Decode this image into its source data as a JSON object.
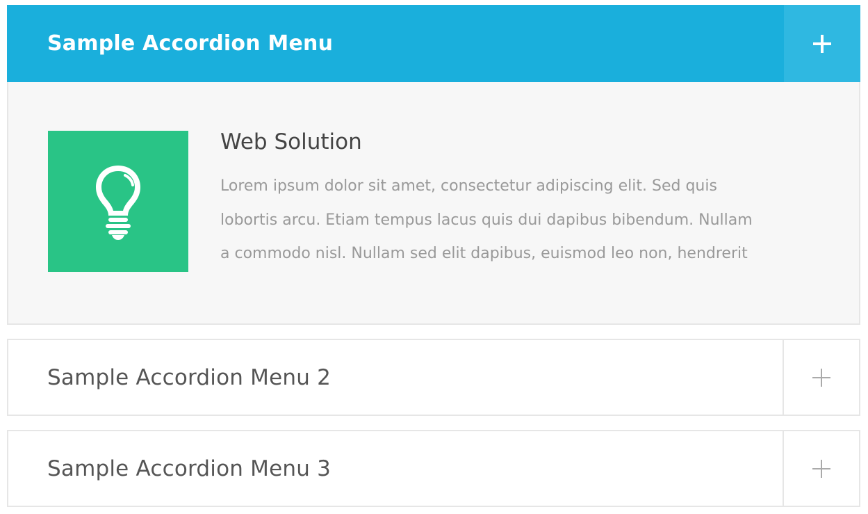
{
  "accordion": {
    "items": [
      {
        "title": "Sample Accordion Menu",
        "expanded": true,
        "toggle_icon": "plus-icon",
        "content": {
          "icon": "lightbulb-icon",
          "icon_bg_color": "#29c486",
          "heading": "Web Solution",
          "body": "Lorem ipsum dolor sit amet, consectetur adipiscing elit. Sed quis\nlobortis arcu. Etiam tempus lacus quis dui dapibus bibendum. Nullam\na commodo nisl. Nullam sed elit dapibus, euismod leo non, hendrerit"
        }
      },
      {
        "title": "Sample Accordion Menu 2",
        "expanded": false,
        "toggle_icon": "plus-icon"
      },
      {
        "title": "Sample Accordion Menu 3",
        "expanded": false,
        "toggle_icon": "plus-icon"
      }
    ]
  },
  "colors": {
    "active_header": "#1aafdc",
    "active_toggle": "#2fb8e1",
    "icon_box": "#29c486",
    "panel_bg": "#f7f7f7",
    "border": "#e6e6e6"
  }
}
